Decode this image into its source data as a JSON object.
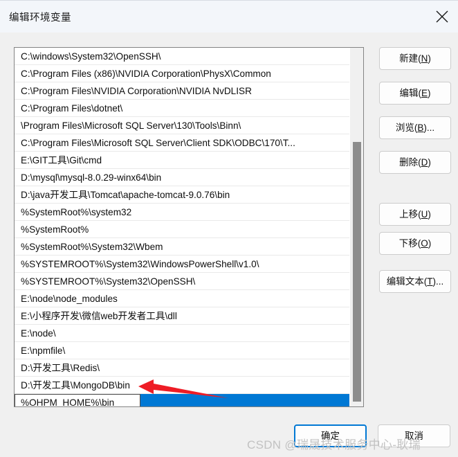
{
  "window": {
    "title": "编辑环境变量",
    "close_icon": "close-icon"
  },
  "path_list": {
    "entries": [
      "C:\\windows\\System32\\OpenSSH\\",
      "C:\\Program Files (x86)\\NVIDIA Corporation\\PhysX\\Common",
      "C:\\Program Files\\NVIDIA Corporation\\NVIDIA NvDLISR",
      "C:\\Program Files\\dotnet\\",
      "\\Program Files\\Microsoft SQL Server\\130\\Tools\\Binn\\",
      "C:\\Program Files\\Microsoft SQL Server\\Client SDK\\ODBC\\170\\T...",
      "E:\\GIT工具\\Git\\cmd",
      "D:\\mysql\\mysql-8.0.29-winx64\\bin",
      "D:\\java开发工具\\Tomcat\\apache-tomcat-9.0.76\\bin",
      "%SystemRoot%\\system32",
      "%SystemRoot%",
      "%SystemRoot%\\System32\\Wbem",
      "%SYSTEMROOT%\\System32\\WindowsPowerShell\\v1.0\\",
      "%SYSTEMROOT%\\System32\\OpenSSH\\",
      "E:\\node\\node_modules",
      "E:\\小程序开发\\微信web开发者工具\\dll",
      "E:\\node\\",
      "E:\\npmfile\\",
      "D:\\开发工具\\Redis\\",
      "D:\\开发工具\\MongoDB\\bin"
    ],
    "selected_index": 20,
    "selected_value": "%OHPM_HOME%\\bin",
    "selection_color": "#0078d4"
  },
  "side_buttons": [
    {
      "label": "新建(N)",
      "text": "新建(",
      "mnemonic": "N",
      "tail": ")",
      "name": "new-button"
    },
    {
      "label": "编辑(E)",
      "text": "编辑(",
      "mnemonic": "E",
      "tail": ")",
      "name": "edit-button"
    },
    {
      "label": "浏览(B)...",
      "text": "浏览(",
      "mnemonic": "B",
      "tail": ")...",
      "name": "browse-button"
    },
    {
      "label": "删除(D)",
      "text": "删除(",
      "mnemonic": "D",
      "tail": ")",
      "name": "delete-button"
    },
    {
      "label": "上移(U)",
      "text": "上移(",
      "mnemonic": "U",
      "tail": ")",
      "name": "move-up-button"
    },
    {
      "label": "下移(O)",
      "text": "下移(",
      "mnemonic": "O",
      "tail": ")",
      "name": "move-down-button"
    },
    {
      "label": "编辑文本(T)...",
      "text": "编辑文本(",
      "mnemonic": "T",
      "tail": ")...",
      "name": "edit-text-button"
    }
  ],
  "bottom_buttons": {
    "ok_label": "确定",
    "cancel_label": "取消",
    "focus_color": "#0078d4"
  },
  "annotation": {
    "arrow_color": "#ee1c25",
    "arrow_direction": "left"
  },
  "watermark": {
    "text": "CSDN @瑞晟技术服务中心-耿瑞"
  }
}
